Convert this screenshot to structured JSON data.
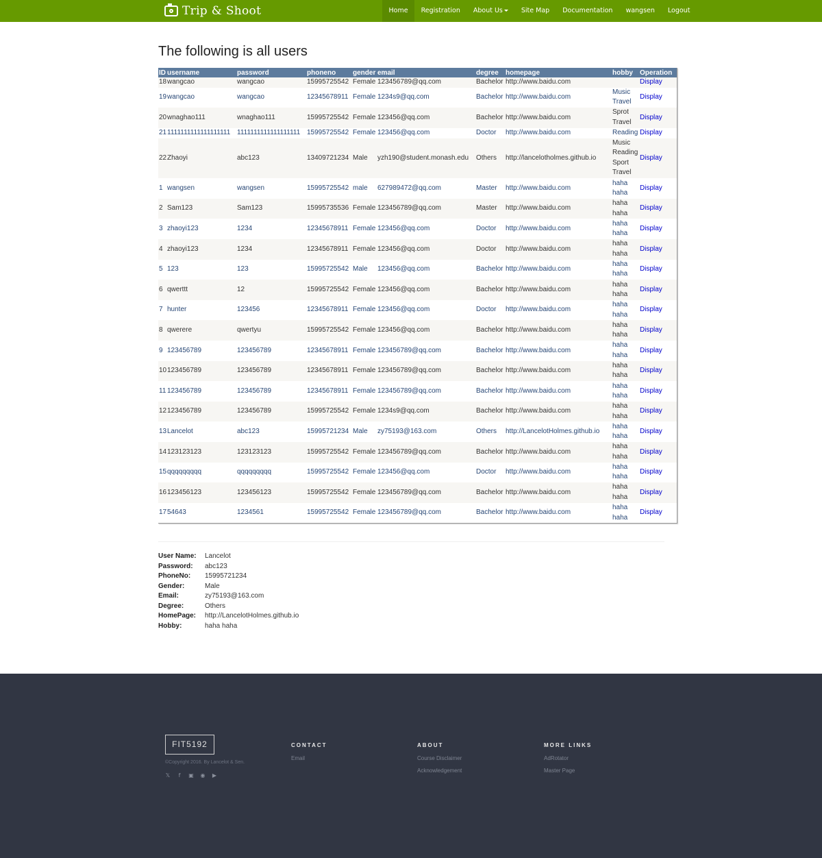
{
  "navbar": {
    "brand": "Trip & Shoot",
    "items": [
      "Home",
      "Registration",
      "About Us",
      "Site Map",
      "Documentation",
      "wangsen",
      "Logout"
    ]
  },
  "page_title": "The following is all users",
  "table": {
    "headers": [
      "ID",
      "username",
      "password",
      "phoneno",
      "gender",
      "email",
      "degree",
      "homepage",
      "hobby",
      "Operation"
    ],
    "rows": [
      {
        "id": "18",
        "username": "wangcao",
        "password": "wangcao",
        "phone": "15995725542",
        "gender": "Female",
        "email": "123456789@qq.com",
        "degree": "Bachelor",
        "homepage": "http://www.baidu.com",
        "hobby": [],
        "op": "Display"
      },
      {
        "id": "19",
        "username": "wangcao",
        "password": "wangcao",
        "phone": "12345678911",
        "gender": "Female",
        "email": "1234s9@qq.com",
        "degree": "Bachelor",
        "homepage": "http://www.baidu.com",
        "hobby": [
          "Music",
          "Travel"
        ],
        "op": "Display"
      },
      {
        "id": "20",
        "username": "wnaghao111",
        "password": "wnaghao111",
        "phone": "15995725542",
        "gender": "Female",
        "email": "123456@qq.com",
        "degree": "Bachelor",
        "homepage": "http://www.baidu.com",
        "hobby": [
          "Sprot",
          "Travel"
        ],
        "op": "Display"
      },
      {
        "id": "21",
        "username": "1111111111111111111",
        "password": "1111111111111111111",
        "phone": "15995725542",
        "gender": "Female",
        "email": "123456@qq.com",
        "degree": "Doctor",
        "homepage": "http://www.baidu.com",
        "hobby": [
          "Reading"
        ],
        "op": "Display"
      },
      {
        "id": "22",
        "username": "Zhaoyi",
        "password": "abc123",
        "phone": "13409721234",
        "gender": "Male",
        "email": "yzh190@student.monash.edu",
        "degree": "Others",
        "homepage": "http://lancelotholmes.github.io",
        "hobby": [
          "Music",
          "Reading",
          "Sport",
          "Travel"
        ],
        "op": "Display"
      },
      {
        "id": "1",
        "username": "wangsen",
        "password": "wangsen",
        "phone": "15995725542",
        "gender": "male",
        "email": "627989472@qq.com",
        "degree": "Master",
        "homepage": "http://www.baidu.com",
        "hobby": [
          "haha",
          "haha"
        ],
        "op": "Display"
      },
      {
        "id": "2",
        "username": "Sam123",
        "password": "Sam123",
        "phone": "15995735536",
        "gender": "Female",
        "email": "123456789@qq.com",
        "degree": "Master",
        "homepage": "http://www.baidu.com",
        "hobby": [
          "haha",
          "haha"
        ],
        "op": "Display"
      },
      {
        "id": "3",
        "username": "zhaoyi123",
        "password": "1234",
        "phone": "12345678911",
        "gender": "Female",
        "email": "123456@qq.com",
        "degree": "Doctor",
        "homepage": "http://www.baidu.com",
        "hobby": [
          "haha",
          "haha"
        ],
        "op": "Display"
      },
      {
        "id": "4",
        "username": "zhaoyi123",
        "password": "1234",
        "phone": "12345678911",
        "gender": "Female",
        "email": "123456@qq.com",
        "degree": "Doctor",
        "homepage": "http://www.baidu.com",
        "hobby": [
          "haha",
          "haha"
        ],
        "op": "Display"
      },
      {
        "id": "5",
        "username": "123",
        "password": "123",
        "phone": "15995725542",
        "gender": "Male",
        "email": "123456@qq.com",
        "degree": "Bachelor",
        "homepage": "http://www.baidu.com",
        "hobby": [
          "haha",
          "haha"
        ],
        "op": "Display"
      },
      {
        "id": "6",
        "username": "qwerttt",
        "password": "12",
        "phone": "15995725542",
        "gender": "Female",
        "email": "123456@qq.com",
        "degree": "Bachelor",
        "homepage": "http://www.baidu.com",
        "hobby": [
          "haha",
          "haha"
        ],
        "op": "Display"
      },
      {
        "id": "7",
        "username": "hunter",
        "password": "123456",
        "phone": "12345678911",
        "gender": "Female",
        "email": "123456@qq.com",
        "degree": "Doctor",
        "homepage": "http://www.baidu.com",
        "hobby": [
          "haha",
          "haha"
        ],
        "op": "Display"
      },
      {
        "id": "8",
        "username": "qwerere",
        "password": "qwertyu",
        "phone": "15995725542",
        "gender": "Female",
        "email": "123456@qq.com",
        "degree": "Bachelor",
        "homepage": "http://www.baidu.com",
        "hobby": [
          "haha",
          "haha"
        ],
        "op": "Display"
      },
      {
        "id": "9",
        "username": "123456789",
        "password": "123456789",
        "phone": "12345678911",
        "gender": "Female",
        "email": "123456789@qq.com",
        "degree": "Bachelor",
        "homepage": "http://www.baidu.com",
        "hobby": [
          "haha",
          "haha"
        ],
        "op": "Display"
      },
      {
        "id": "10",
        "username": "123456789",
        "password": "123456789",
        "phone": "12345678911",
        "gender": "Female",
        "email": "123456789@qq.com",
        "degree": "Bachelor",
        "homepage": "http://www.baidu.com",
        "hobby": [
          "haha",
          "haha"
        ],
        "op": "Display"
      },
      {
        "id": "11",
        "username": "123456789",
        "password": "123456789",
        "phone": "12345678911",
        "gender": "Female",
        "email": "123456789@qq.com",
        "degree": "Bachelor",
        "homepage": "http://www.baidu.com",
        "hobby": [
          "haha",
          "haha"
        ],
        "op": "Display"
      },
      {
        "id": "12",
        "username": "123456789",
        "password": "123456789",
        "phone": "15995725542",
        "gender": "Female",
        "email": "1234s9@qq.com",
        "degree": "Bachelor",
        "homepage": "http://www.baidu.com",
        "hobby": [
          "haha",
          "haha"
        ],
        "op": "Display"
      },
      {
        "id": "13",
        "username": "Lancelot",
        "password": "abc123",
        "phone": "15995721234",
        "gender": "Male",
        "email": "zy75193@163.com",
        "degree": "Others",
        "homepage": "http://LancelotHolmes.github.io",
        "hobby": [
          "haha",
          "haha"
        ],
        "op": "Display"
      },
      {
        "id": "14",
        "username": "123123123",
        "password": "123123123",
        "phone": "15995725542",
        "gender": "Female",
        "email": "123456789@qq.com",
        "degree": "Bachelor",
        "homepage": "http://www.baidu.com",
        "hobby": [
          "haha",
          "haha"
        ],
        "op": "Display"
      },
      {
        "id": "15",
        "username": "qqqqqqqqq",
        "password": "qqqqqqqqq",
        "phone": "15995725542",
        "gender": "Female",
        "email": "123456@qq.com",
        "degree": "Doctor",
        "homepage": "http://www.baidu.com",
        "hobby": [
          "haha",
          "haha"
        ],
        "op": "Display"
      },
      {
        "id": "16",
        "username": "123456123",
        "password": "123456123",
        "phone": "15995725542",
        "gender": "Female",
        "email": "123456789@qq.com",
        "degree": "Bachelor",
        "homepage": "http://www.baidu.com",
        "hobby": [
          "haha",
          "haha"
        ],
        "op": "Display"
      },
      {
        "id": "17",
        "username": "54643",
        "password": "1234561",
        "phone": "15995725542",
        "gender": "Female",
        "email": "123456789@qq.com",
        "degree": "Bachelor",
        "homepage": "http://www.baidu.com",
        "hobby": [
          "haha",
          "haha"
        ],
        "op": "Display"
      }
    ]
  },
  "details": [
    {
      "label": "User Name:",
      "value": "Lancelot"
    },
    {
      "label": "Password:",
      "value": "abc123"
    },
    {
      "label": "PhoneNo:",
      "value": "15995721234"
    },
    {
      "label": "Gender:",
      "value": "Male"
    },
    {
      "label": "Email:",
      "value": "zy75193@163.com"
    },
    {
      "label": "Degree:",
      "value": "Others"
    },
    {
      "label": "HomePage:",
      "value": "http://LancelotHolmes.github.io"
    },
    {
      "label": "Hobby:",
      "value": "haha haha"
    }
  ],
  "footer": {
    "logo": "FIT5192",
    "copyright": "©Copyright 2016. By Lancelot & Sen.",
    "social_icons": [
      "twitter-icon",
      "facebook-icon",
      "instagram-icon",
      "github-icon",
      "youtube-icon"
    ],
    "contact": {
      "title": "CONTACT",
      "links": [
        "Email"
      ]
    },
    "about": {
      "title": "ABOUT",
      "links": [
        "Course Disclaimer",
        "Acknowledgement"
      ]
    },
    "more": {
      "title": "MORE LINKS",
      "links": [
        "AdRotator",
        "Master Page"
      ]
    }
  },
  "colors": {
    "navbar": "#669a00",
    "table_header": "#5d7b9d",
    "footer": "#313643"
  }
}
